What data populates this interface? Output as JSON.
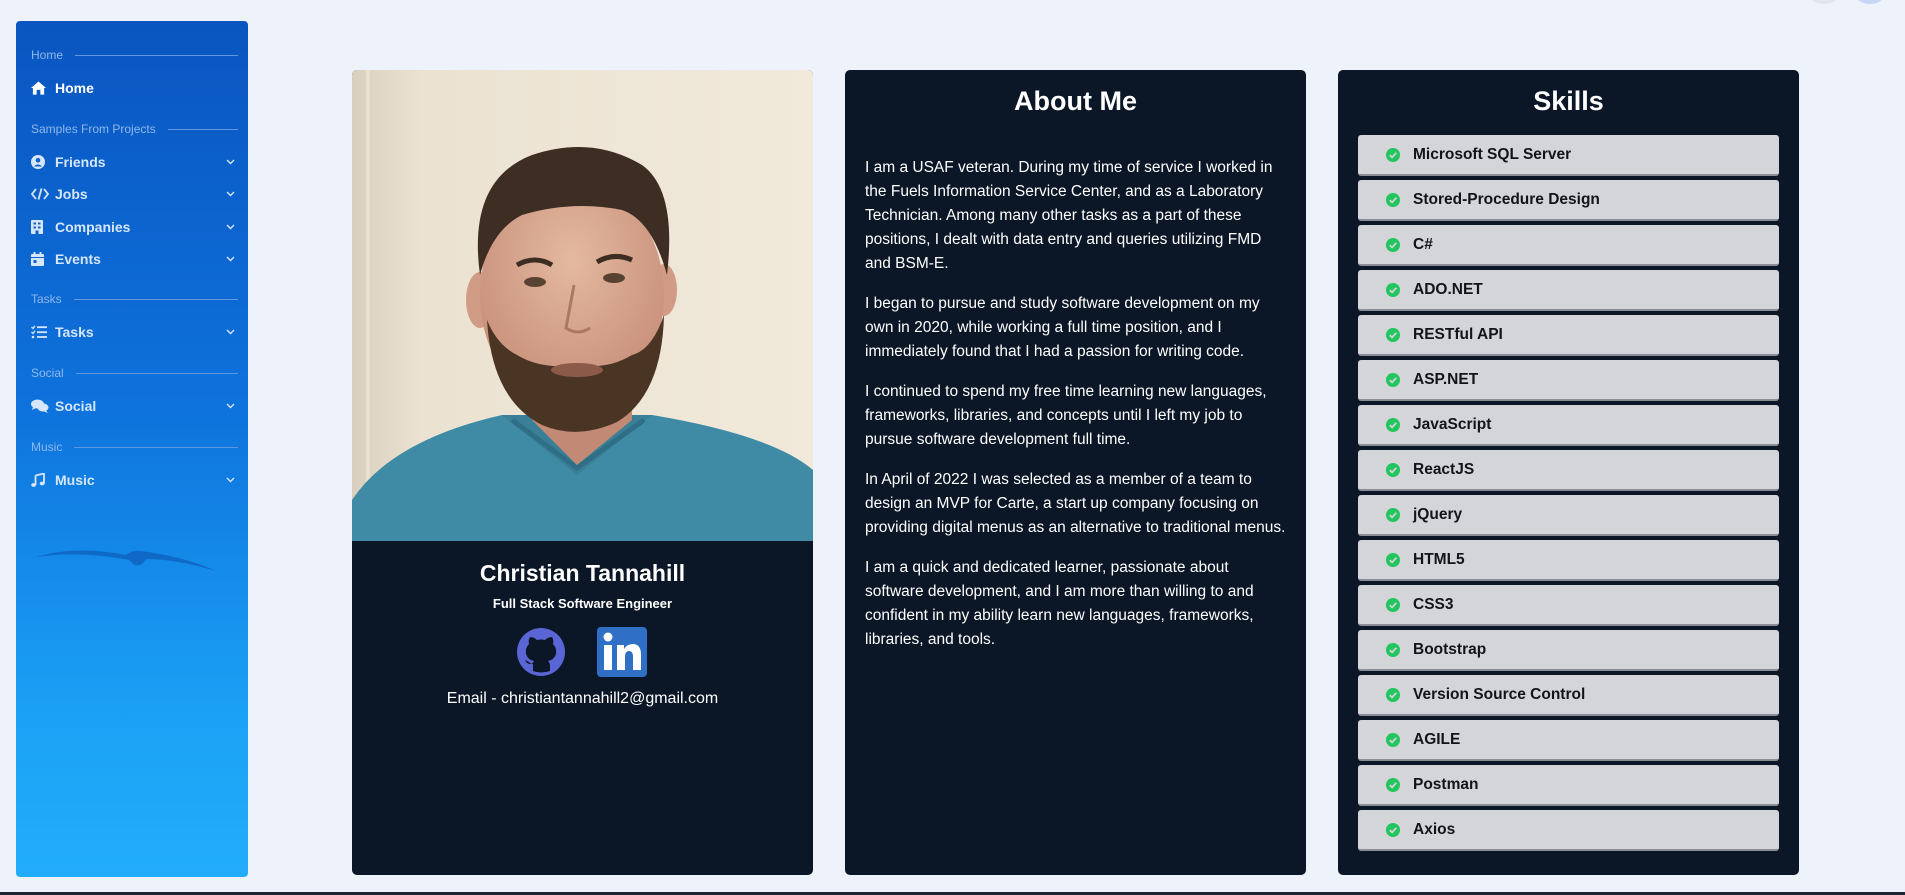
{
  "top": {
    "logo_fragment": ""
  },
  "sidebar": {
    "sections": [
      {
        "heading": "Home",
        "items": [
          {
            "label": "Home",
            "icon": "home-icon",
            "expandable": false,
            "active": true
          }
        ]
      },
      {
        "heading": "Samples From Projects",
        "items": [
          {
            "label": "Friends",
            "icon": "user-circle-icon",
            "expandable": true
          },
          {
            "label": "Jobs",
            "icon": "code-icon",
            "expandable": true
          },
          {
            "label": "Companies",
            "icon": "building-icon",
            "expandable": true
          },
          {
            "label": "Events",
            "icon": "calendar-icon",
            "expandable": true
          }
        ]
      },
      {
        "heading": "Tasks",
        "items": [
          {
            "label": "Tasks",
            "icon": "task-list-icon",
            "expandable": true
          }
        ]
      },
      {
        "heading": "Social",
        "items": [
          {
            "label": "Social",
            "icon": "comments-icon",
            "expandable": true
          }
        ]
      },
      {
        "heading": "Music",
        "items": [
          {
            "label": "Music",
            "icon": "music-icon",
            "expandable": true
          }
        ]
      }
    ]
  },
  "profile": {
    "name": "Christian Tannahill",
    "title": "Full Stack Software Engineer",
    "email": "Email - christiantannahill2@gmail.com",
    "links": [
      {
        "icon": "github-icon"
      },
      {
        "icon": "linkedin-icon"
      }
    ]
  },
  "about": {
    "heading": "About Me",
    "paragraphs": [
      "I am a USAF veteran. During my time of service I worked in the Fuels Information Service Center, and as a Laboratory Technician. Among many other tasks as a part of these positions, I dealt with data entry and queries utilizing FMD and BSM-E.",
      "I began to pursue and study software development on my own in 2020, while working a full time position, and I immediately found that I had a passion for writing code.",
      "I continued to spend my free time learning new languages, frameworks, libraries, and concepts until I left my job to pursue software development full time.",
      "In April of 2022 I was selected as a member of a team to design an MVP for Carte, a start up company focusing on providing digital menus as an alternative to traditional menus.",
      "I am a quick and dedicated learner, passionate about software development, and I am more than willing to and confident in my ability learn new languages, frameworks, libraries, and tools."
    ]
  },
  "skills": {
    "heading": "Skills",
    "items": [
      "Microsoft SQL Server",
      "Stored-Procedure Design",
      "C#",
      "ADO.NET",
      "RESTful API",
      "ASP.NET",
      "JavaScript",
      "ReactJS",
      "jQuery",
      "HTML5",
      "CSS3",
      "Bootstrap",
      "Version Source Control",
      "AGILE",
      "Postman",
      "Axios"
    ]
  },
  "colors": {
    "page_bg": "#eef3fb",
    "card_bg": "#0b1626",
    "skill_bg": "#d3d5d8",
    "check_green": "#22c55e",
    "sidebar_top": "#0a55c0",
    "sidebar_bottom": "#22adfa"
  }
}
